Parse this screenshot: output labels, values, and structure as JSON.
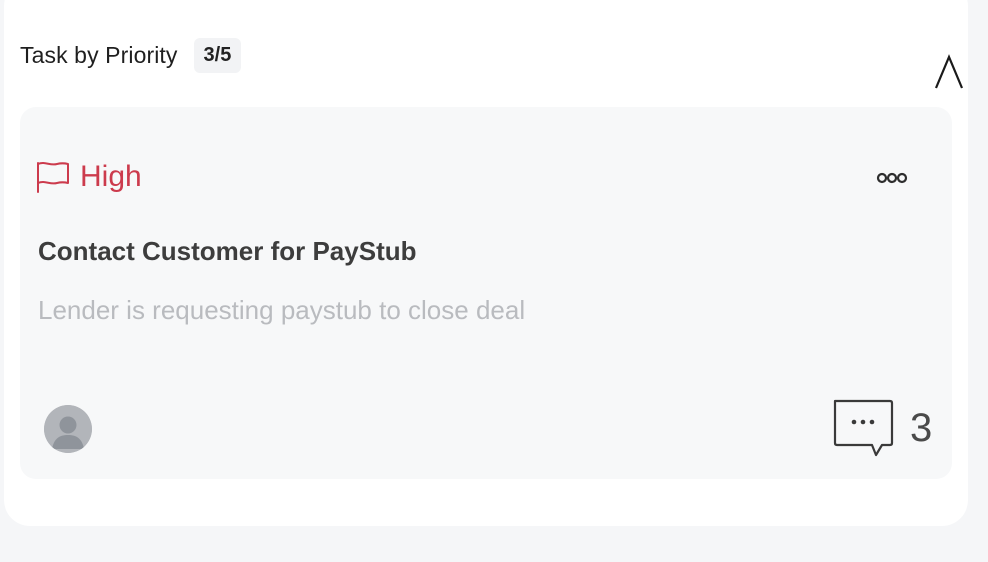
{
  "section": {
    "title": "Task by Priority",
    "count": "3/5",
    "toggle_icon": "chevron-up-icon"
  },
  "task": {
    "priority_label": "High",
    "priority_icon": "flag-icon",
    "priority_color": "#cc3b4d",
    "more_icon": "more-dots-icon",
    "title": "Contact Customer for PayStub",
    "description": "Lender is requesting paystub to close deal",
    "assignee_icon": "user-avatar-icon",
    "comment_icon": "comment-bubble-icon",
    "comment_count": "3"
  }
}
